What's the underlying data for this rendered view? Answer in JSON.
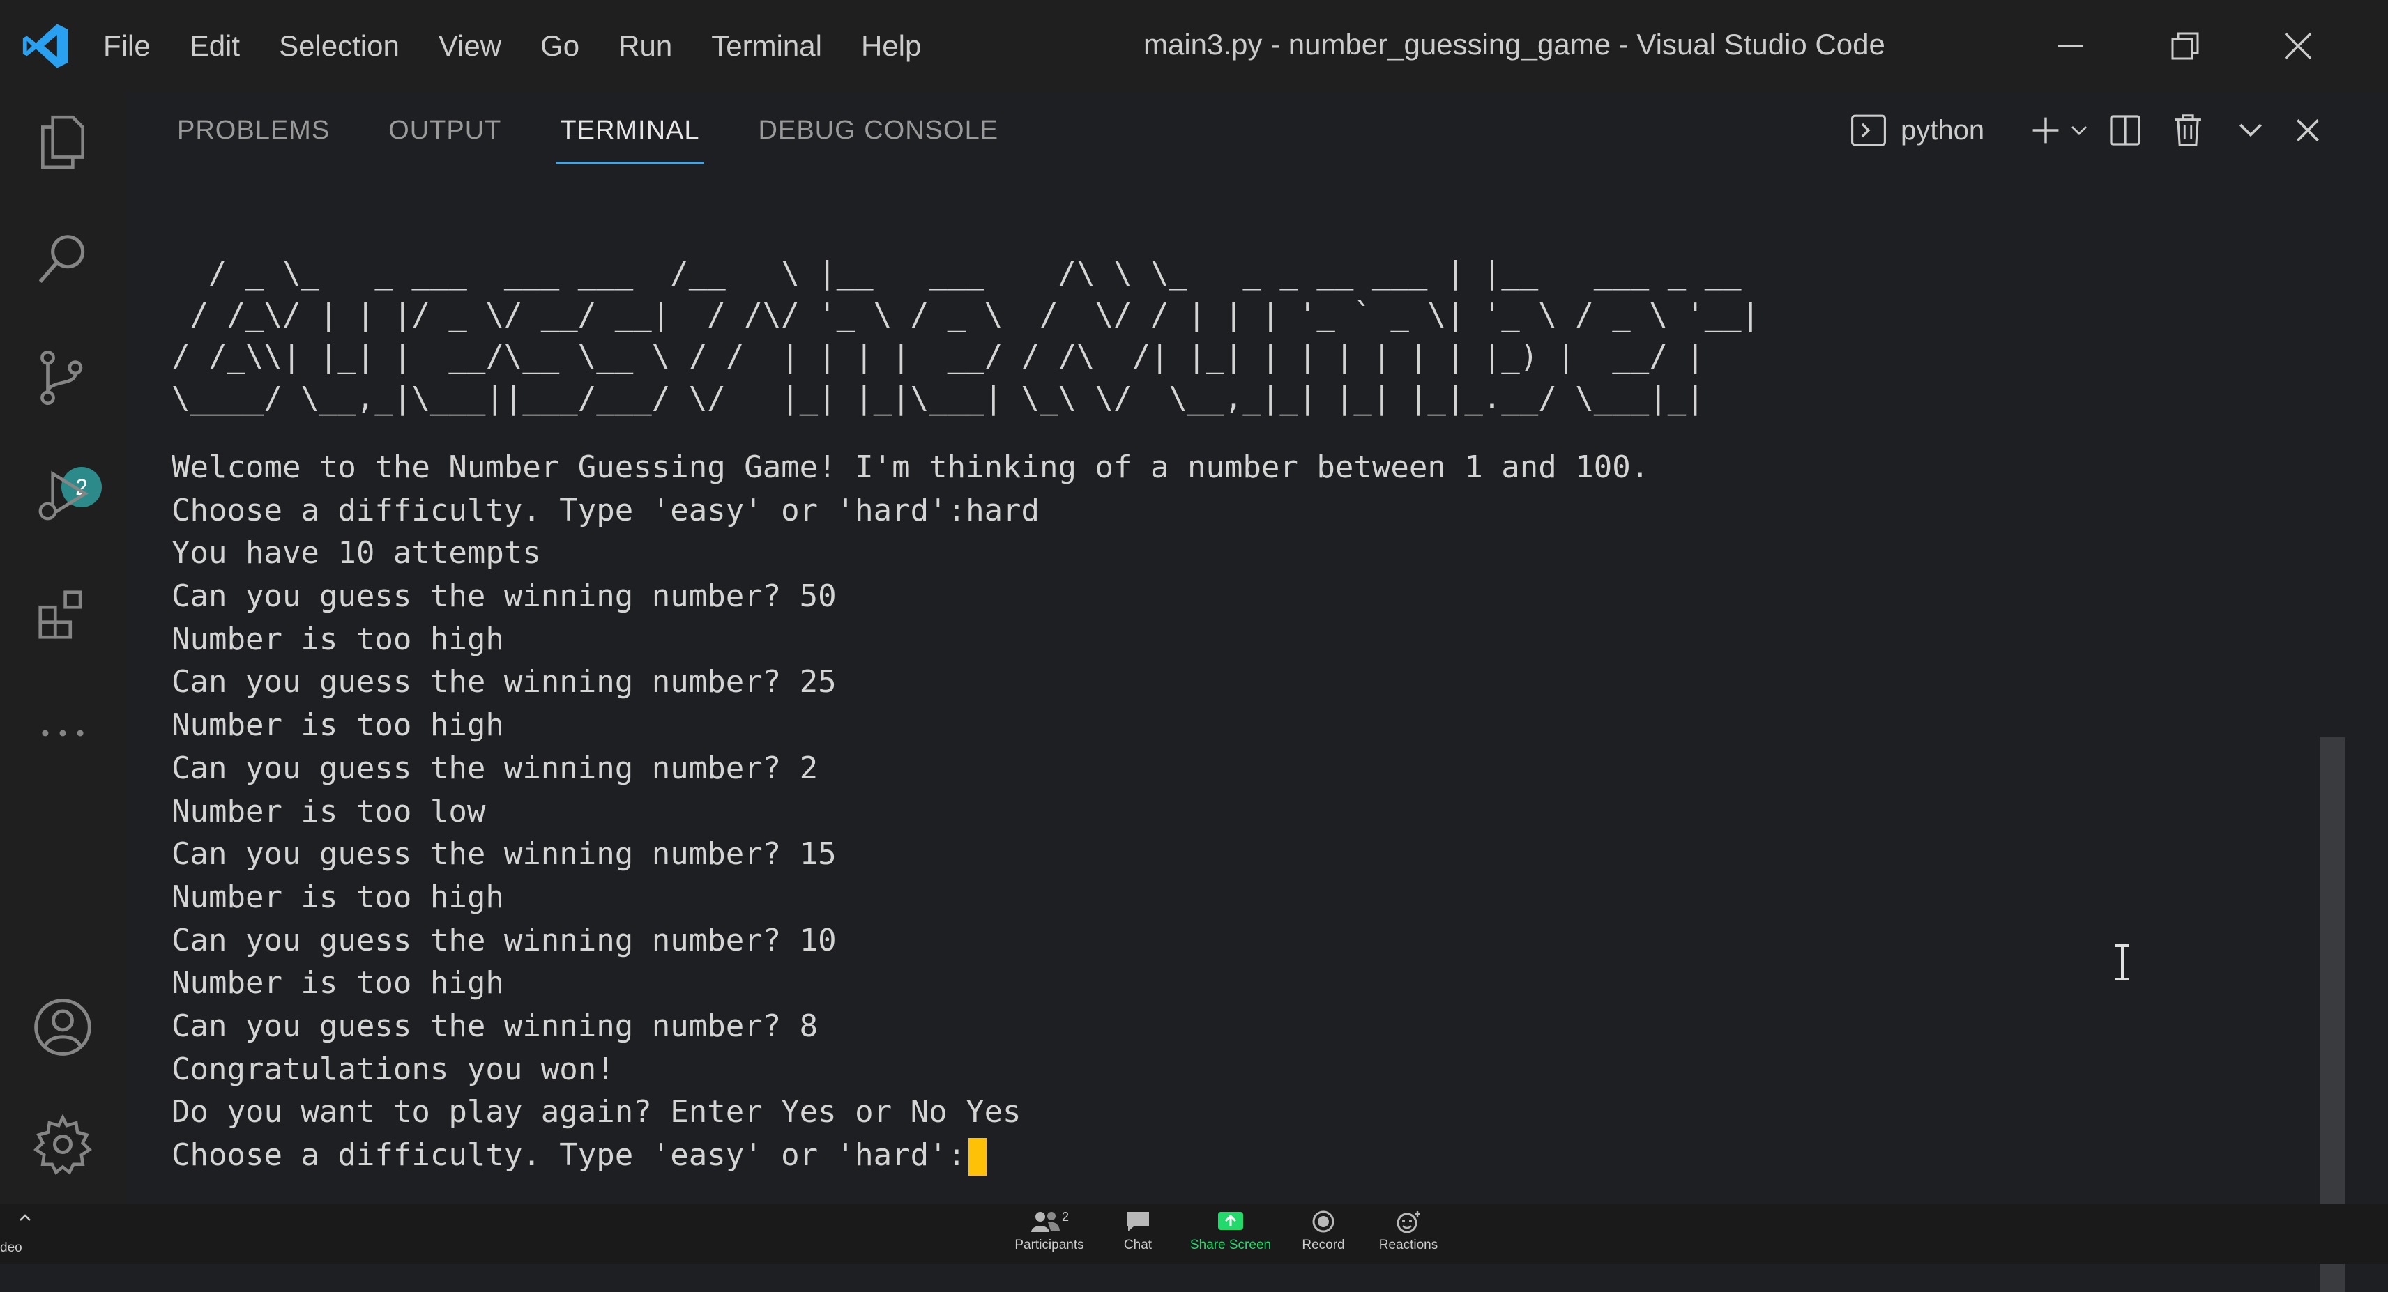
{
  "menu": [
    "File",
    "Edit",
    "Selection",
    "View",
    "Go",
    "Run",
    "Terminal",
    "Help"
  ],
  "window_title": "main3.py - number_guessing_game - Visual Studio Code",
  "activity_bar": {
    "source_control_badge": "2"
  },
  "panel": {
    "tabs": [
      "PROBLEMS",
      "OUTPUT",
      "TERMINAL",
      "DEBUG CONSOLE"
    ],
    "active_tab": "TERMINAL",
    "terminal_name": "python"
  },
  "terminal": {
    "ascii_art": [
      "  / _ \\_   _ ___  ___ ___  /__   \\ |__   ___    /\\ \\ \\_   _ _ __ ___ | |__   ___ _ __",
      " / /_\\/ | | |/ _ \\/ __/ __|  / /\\/ '_ \\ / _ \\  /  \\/ / | | | '_ ` _ \\| '_ \\ / _ \\ '__|",
      "/ /_\\\\| |_| |  __/\\__ \\__ \\ / /  | | | |  __/ / /\\  /| |_| | | | | | | |_) |  __/ |",
      "\\____/ \\__,_|\\___||___/___/ \\/   |_| |_|\\___| \\_\\ \\/  \\__,_|_| |_| |_|_.__/ \\___|_|"
    ],
    "lines": [
      "Welcome to the Number Guessing Game! I'm thinking of a number between 1 and 100.",
      "Choose a difficulty. Type 'easy' or 'hard':hard",
      "You have 10 attempts",
      "Can you guess the winning number? 50",
      "Number is too high",
      "Can you guess the winning number? 25",
      "Number is too high",
      "Can you guess the winning number? 2",
      "Number is too low",
      "Can you guess the winning number? 15",
      "Number is too high",
      "Can you guess the winning number? 10",
      "Number is too high",
      "Can you guess the winning number? 8",
      "Congratulations you won!",
      "Do you want to play again? Enter Yes or No Yes"
    ],
    "prompt": "Choose a difficulty. Type 'easy' or 'hard':"
  },
  "zoom_bar": {
    "left_label": "deo",
    "participants_count": "2",
    "items": [
      "Participants",
      "Chat",
      "Share Screen",
      "Record",
      "Reactions"
    ]
  },
  "colors": {
    "accent": "#4fa1d8",
    "cursor": "#ffc107",
    "share": "#23d96c",
    "badge": "#2d8a8a"
  }
}
